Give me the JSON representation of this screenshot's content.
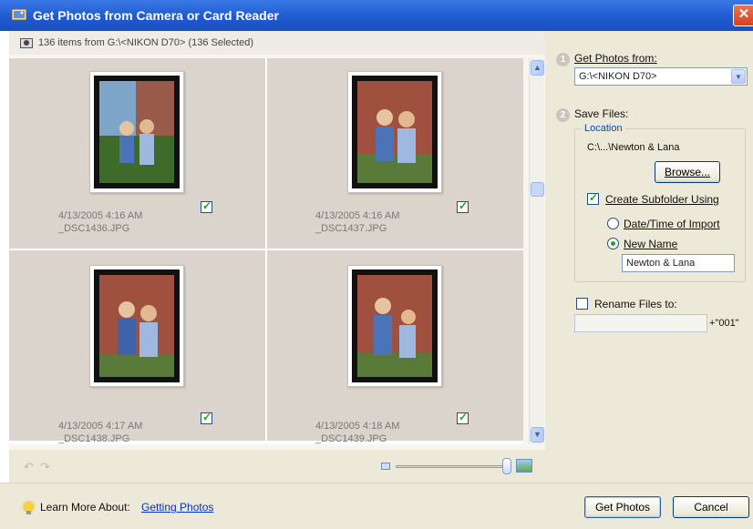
{
  "window": {
    "title": "Get Photos from Camera or Card Reader",
    "close_symbol": "✕"
  },
  "left_header": {
    "summary": "136 items from G:\\<NIKON D70> (136 Selected)"
  },
  "photos": [
    {
      "date": "4/13/2005 4:16 AM",
      "filename": "_DSC1436.JPG",
      "checked": true
    },
    {
      "date": "4/13/2005 4:16 AM",
      "filename": "_DSC1437.JPG",
      "checked": true
    },
    {
      "date": "4/13/2005 4:17 AM",
      "filename": "_DSC1438.JPG",
      "checked": true
    },
    {
      "date": "4/13/2005 4:18 AM",
      "filename": "_DSC1439.JPG",
      "checked": true
    }
  ],
  "scroll": {
    "up_symbol": "▲",
    "down_symbol": "▼"
  },
  "rotate": {
    "left_symbol": "↶",
    "right_symbol": "↷"
  },
  "right_panel": {
    "step1_number": "1",
    "get_photos_from_label": "Get Photos from:",
    "source_value": "G:\\<NIKON D70>",
    "dropdown_symbol": "▼",
    "step2_number": "2",
    "save_files_label": "Save Files:",
    "location_legend": "Location",
    "location_path": "C:\\...\\Newton & Lana",
    "browse_label": "Browse...",
    "create_subfolder_label": "Create Subfolder Using",
    "create_subfolder_checked": true,
    "option_date": "Date/Time of Import",
    "option_name": "New Name",
    "selected_option": "New Name",
    "new_name_value": "Newton & Lana",
    "rename_label": "Rename Files to:",
    "rename_checked": false,
    "rename_value": "",
    "rename_suffix": "+\"001\""
  },
  "footer": {
    "learn_more_label": "Learn More About:",
    "learn_more_link": "Getting Photos",
    "get_photos_button": "Get Photos",
    "cancel_button": "Cancel"
  }
}
